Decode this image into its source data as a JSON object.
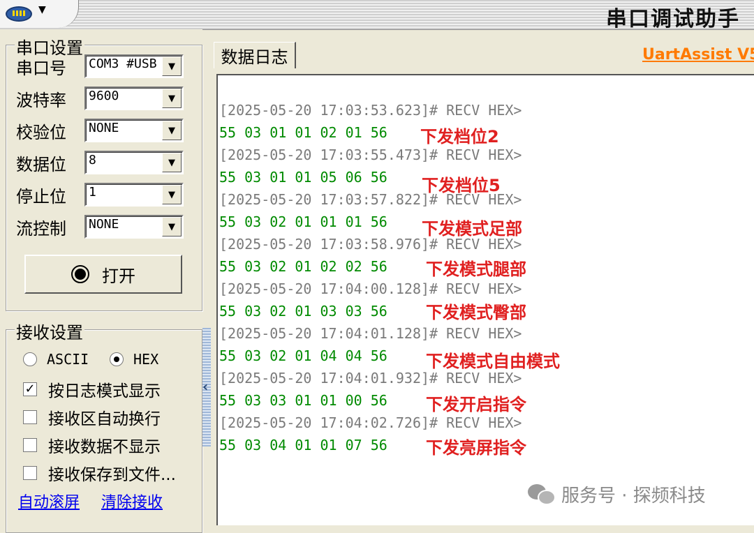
{
  "window": {
    "title": "串口调试助手",
    "menu_arrow": "▼"
  },
  "serial_settings": {
    "legend": "串口设置",
    "fields": [
      {
        "label": "串口号",
        "value": "COM3 #USB"
      },
      {
        "label": "波特率",
        "value": "9600"
      },
      {
        "label": "校验位",
        "value": "NONE"
      },
      {
        "label": "数据位",
        "value": "8"
      },
      {
        "label": "停止位",
        "value": "1"
      },
      {
        "label": "流控制",
        "value": "NONE"
      }
    ],
    "open_button": "打开"
  },
  "receive_settings": {
    "legend": "接收设置",
    "modes": [
      {
        "label": "ASCII",
        "selected": false
      },
      {
        "label": "HEX",
        "selected": true
      }
    ],
    "options": [
      {
        "label": "按日志模式显示",
        "checked": true
      },
      {
        "label": "接收区自动换行",
        "checked": false
      },
      {
        "label": "接收数据不显示",
        "checked": false
      },
      {
        "label": "接收保存到文件...",
        "checked": false
      }
    ],
    "links": [
      "自动滚屏",
      "清除接收"
    ]
  },
  "log_panel": {
    "tab": "数据日志",
    "brand": "UartAssist V5.",
    "entries": [
      {
        "header": "[2025-05-20 17:03:53.623]# RECV HEX>",
        "data": "55 03 01 01 02 01 56",
        "note": "下发档位2"
      },
      {
        "header": "[2025-05-20 17:03:55.473]# RECV HEX>",
        "data": "55 03 01 01 05 06 56",
        "note": "下发档位5"
      },
      {
        "header": "[2025-05-20 17:03:57.822]# RECV HEX>",
        "data": "55 03 02 01 01 01 56",
        "note": "下发模式足部"
      },
      {
        "header": "[2025-05-20 17:03:58.976]# RECV HEX>",
        "data": "55 03 02 01 02 02 56",
        "note": "下发模式腿部"
      },
      {
        "header": "[2025-05-20 17:04:00.128]# RECV HEX>",
        "data": "55 03 02 01 03 03 56",
        "note": "下发模式臀部"
      },
      {
        "header": "[2025-05-20 17:04:01.128]# RECV HEX>",
        "data": "55 03 02 01 04 04 56",
        "note": "下发模式自由模式"
      },
      {
        "header": "[2025-05-20 17:04:01.932]# RECV HEX>",
        "data": "55 03 03 01 01 00 56",
        "note": "下发开启指令"
      },
      {
        "header": "[2025-05-20 17:04:02.726]# RECV HEX>",
        "data": "55 03 04 01 01 07 56",
        "note": "下发亮屏指令"
      }
    ]
  },
  "watermark": "服务号 · 探频科技"
}
